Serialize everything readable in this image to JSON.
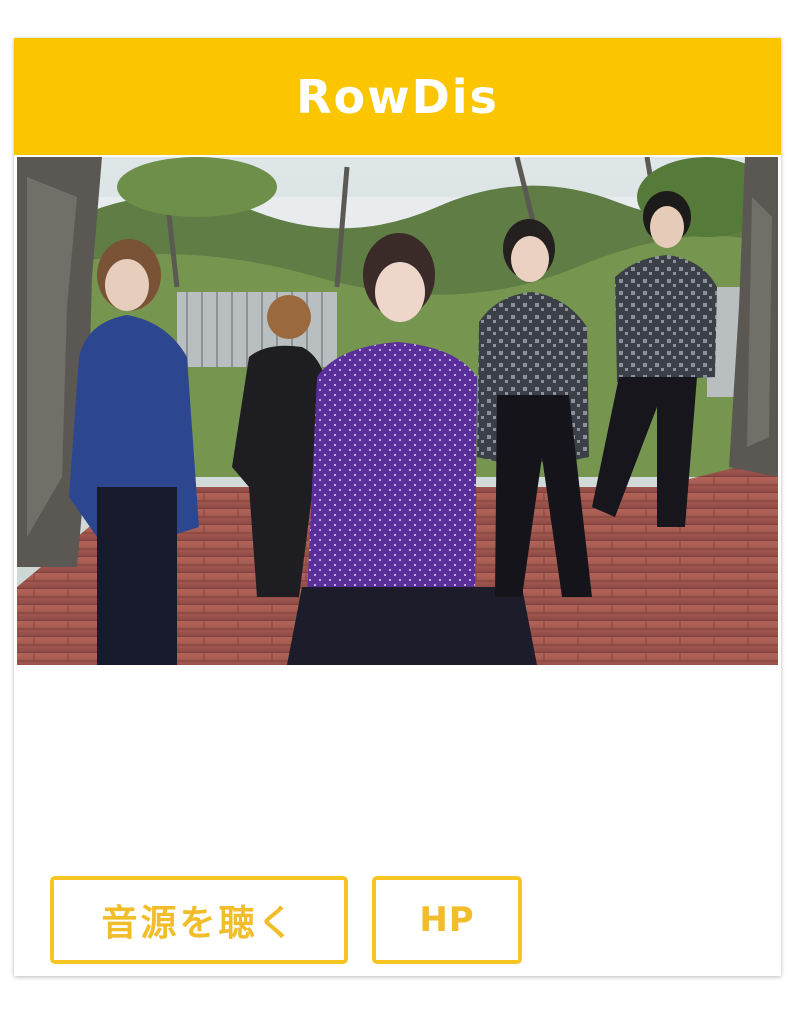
{
  "card": {
    "title": "RowDis",
    "header_color": "#fbc500",
    "accent_color": "#f7c523"
  },
  "photo": {
    "subject": "band-photo"
  },
  "buttons": {
    "listen_label": "音源を聴く",
    "hp_label": "HP"
  }
}
